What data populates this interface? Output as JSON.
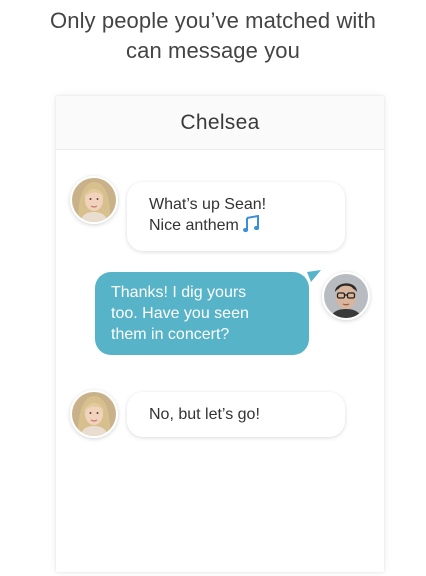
{
  "headline": {
    "line1": "Only people you’ve matched with",
    "line2": "can message you"
  },
  "chat": {
    "title": "Chelsea",
    "messages": [
      {
        "sender": "Chelsea",
        "direction": "incoming",
        "lines": [
          "What’s up Sean!",
          "Nice anthem"
        ],
        "emoji": "music-note"
      },
      {
        "sender": "Sean",
        "direction": "outgoing",
        "lines": [
          "Thanks! I dig yours",
          "too. Have you seen",
          "them in concert?"
        ]
      },
      {
        "sender": "Chelsea",
        "direction": "incoming",
        "lines": [
          "No, but let’s go!"
        ]
      }
    ]
  },
  "colors": {
    "outgoing_bubble": "#56b3c8",
    "incoming_bubble": "#ffffff",
    "music_note": "#3b8fd9",
    "headline_text": "#444444"
  }
}
